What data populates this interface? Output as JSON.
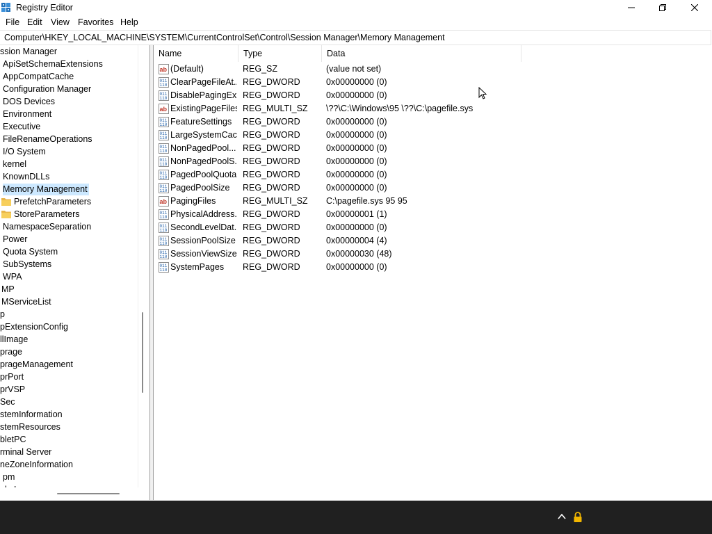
{
  "window": {
    "title": "Registry Editor"
  },
  "menu": [
    "File",
    "Edit",
    "View",
    "Favorites",
    "Help"
  ],
  "address": "Computer\\HKEY_LOCAL_MACHINE\\SYSTEM\\CurrentControlSet\\Control\\Session Manager\\Memory Management",
  "tree": [
    "ssion Manager",
    "ApiSetSchemaExtensions",
    "AppCompatCache",
    "Configuration Manager",
    "DOS Devices",
    "Environment",
    "Executive",
    "FileRenameOperations",
    "I/O System",
    "kernel",
    "KnownDLLs",
    "Memory Management",
    "PrefetchParameters",
    "StoreParameters",
    "NamespaceSeparation",
    "Power",
    "Quota System",
    "SubSystems",
    "WPA",
    "MP",
    "MServiceList",
    "p",
    "pExtensionConfig",
    "llImage",
    "prage",
    "prageManagement",
    "prPort",
    "prVSP",
    "Sec",
    "stemInformation",
    "stemResources",
    "bletPC",
    "rminal Server",
    "neZoneInformation",
    "pm",
    "nl...L"
  ],
  "columns": {
    "name": "Name",
    "type": "Type",
    "data": "Data"
  },
  "values": [
    {
      "icon": "string-value-icon",
      "name": "(Default)",
      "type": "REG_SZ",
      "data": "(value not set)"
    },
    {
      "icon": "binary-value-icon",
      "name": "ClearPageFileAt...",
      "type": "REG_DWORD",
      "data": "0x00000000 (0)"
    },
    {
      "icon": "binary-value-icon",
      "name": "DisablePagingEx...",
      "type": "REG_DWORD",
      "data": "0x00000000 (0)"
    },
    {
      "icon": "string-value-icon",
      "name": "ExistingPageFiles",
      "type": "REG_MULTI_SZ",
      "data": "\\??\\C:\\Windows\\95 \\??\\C:\\pagefile.sys"
    },
    {
      "icon": "binary-value-icon",
      "name": "FeatureSettings",
      "type": "REG_DWORD",
      "data": "0x00000000 (0)"
    },
    {
      "icon": "binary-value-icon",
      "name": "LargeSystemCac...",
      "type": "REG_DWORD",
      "data": "0x00000000 (0)"
    },
    {
      "icon": "binary-value-icon",
      "name": "NonPagedPool...",
      "type": "REG_DWORD",
      "data": "0x00000000 (0)"
    },
    {
      "icon": "binary-value-icon",
      "name": "NonPagedPoolS...",
      "type": "REG_DWORD",
      "data": "0x00000000 (0)"
    },
    {
      "icon": "binary-value-icon",
      "name": "PagedPoolQuota",
      "type": "REG_DWORD",
      "data": "0x00000000 (0)"
    },
    {
      "icon": "binary-value-icon",
      "name": "PagedPoolSize",
      "type": "REG_DWORD",
      "data": "0x00000000 (0)"
    },
    {
      "icon": "string-value-icon",
      "name": "PagingFiles",
      "type": "REG_MULTI_SZ",
      "data": "C:\\pagefile.sys 95 95"
    },
    {
      "icon": "binary-value-icon",
      "name": "PhysicalAddress...",
      "type": "REG_DWORD",
      "data": "0x00000001 (1)"
    },
    {
      "icon": "binary-value-icon",
      "name": "SecondLevelDat...",
      "type": "REG_DWORD",
      "data": "0x00000000 (0)"
    },
    {
      "icon": "binary-value-icon",
      "name": "SessionPoolSize",
      "type": "REG_DWORD",
      "data": "0x00000004 (4)"
    },
    {
      "icon": "binary-value-icon",
      "name": "SessionViewSize",
      "type": "REG_DWORD",
      "data": "0x00000030 (48)"
    },
    {
      "icon": "binary-value-icon",
      "name": "SystemPages",
      "type": "REG_DWORD",
      "data": "0x00000000 (0)"
    }
  ],
  "colors": {
    "selection": "#cce8ff",
    "taskbar": "#202020",
    "lock": "#f2b600"
  }
}
